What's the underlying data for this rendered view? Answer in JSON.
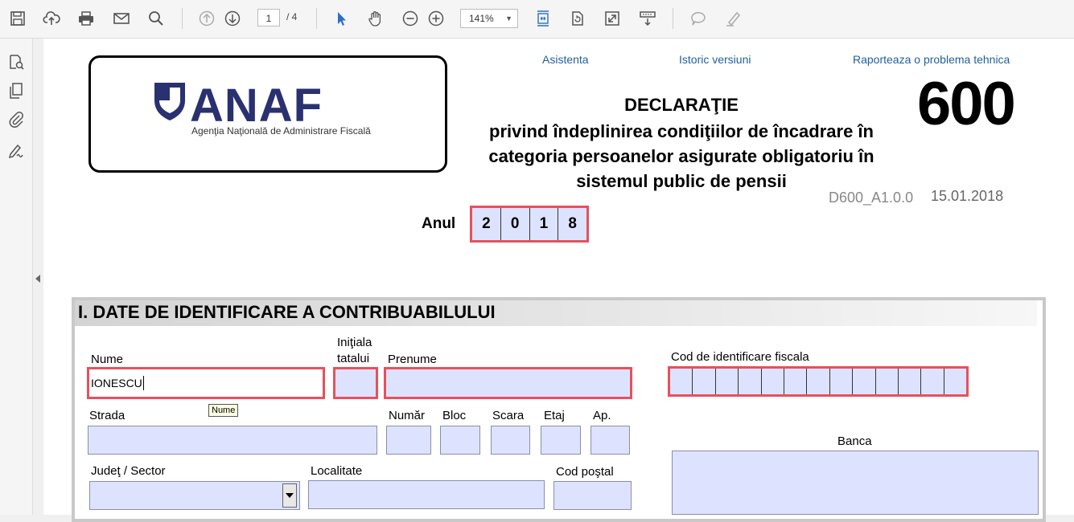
{
  "toolbar": {
    "page_current": "1",
    "page_total": "/ 4",
    "zoom": "141%",
    "buttons": [
      "save-icon",
      "upload-icon",
      "print-icon",
      "mail-icon",
      "search-icon",
      "prev-page-icon",
      "next-page-icon",
      "select-icon",
      "hand-icon",
      "zoom-out-icon",
      "zoom-in-icon",
      "fit-width-icon",
      "rotate-icon",
      "fullscreen-icon",
      "scroll-mode-icon",
      "comment-icon",
      "highlight-icon"
    ]
  },
  "header_links": {
    "asistenta": "Asistenta",
    "istoric": "Istoric versiuni",
    "raporteaza": "Raporteaza o problema tehnica"
  },
  "logo": {
    "word": "ANAF",
    "subtitle": "Agenţia Naţională de Administrare Fiscală"
  },
  "declaration": {
    "title": "DECLARAŢIE",
    "subtitle": "privind îndeplinirea condiţiilor de încadrare în categoria persoanelor asigurate obligatoriu în sistemul public de pensii",
    "number": "600",
    "code": "D600_A1.0.0",
    "date": "15.01.2018"
  },
  "year": {
    "label": "Anul",
    "digits": [
      "2",
      "0",
      "1",
      "8"
    ]
  },
  "section1": {
    "title": "I. DATE DE IDENTIFICARE A CONTRIBUABILULUI",
    "labels": {
      "nume": "Nume",
      "initiala1": "Iniţiala",
      "initiala2": "tatalui",
      "prenume": "Prenume",
      "cif": "Cod de identificare fiscala",
      "strada": "Strada",
      "numar": "Număr",
      "bloc": "Bloc",
      "scara": "Scara",
      "etaj": "Etaj",
      "ap": "Ap.",
      "banca": "Banca",
      "judet": "Judeţ / Sector",
      "localitate": "Localitate",
      "cod_postal": "Cod poştal"
    },
    "values": {
      "nume": "IONESCU"
    },
    "tooltip": "Nume"
  },
  "colors": {
    "required_border": "#e8505b",
    "field_fill": "#dde3ff",
    "link": "#1f5f9f",
    "logo": "#2a3170"
  }
}
